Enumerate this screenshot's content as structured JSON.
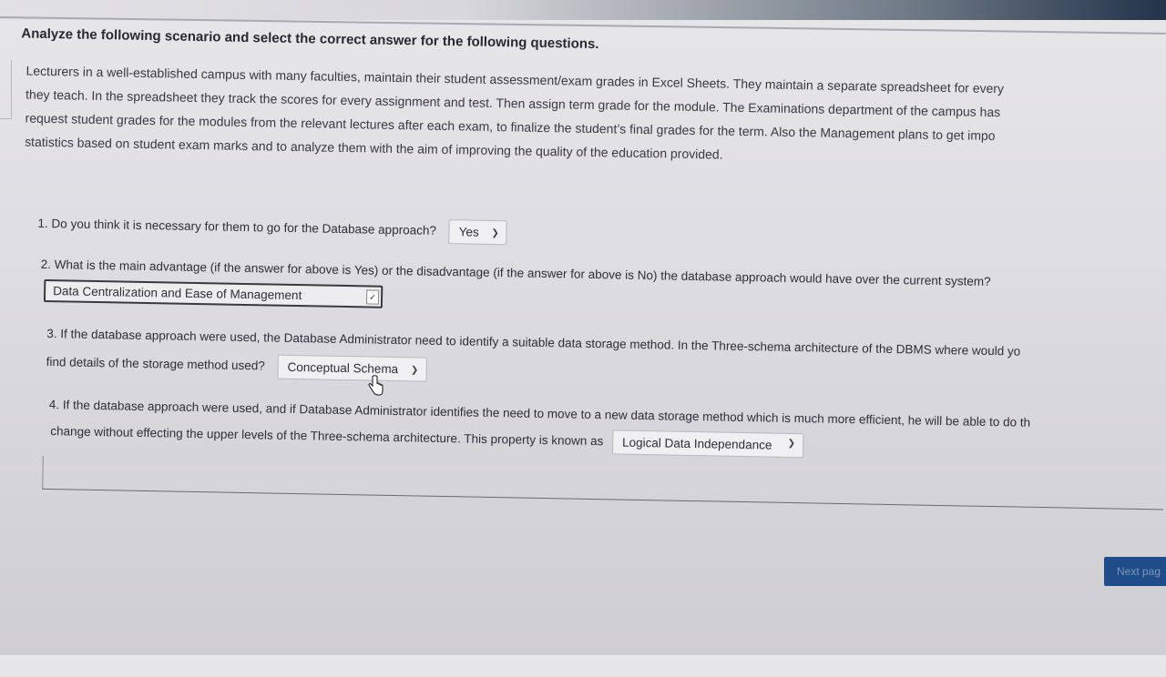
{
  "heading": "Analyze the following scenario and select the correct answer for the following questions.",
  "scenario_lines": [
    "Lecturers in a well-established campus with many faculties, maintain their student assessment/exam grades in Excel Sheets. They maintain a separate spreadsheet for every",
    "they teach. In the spreadsheet they track the scores for every assignment and test. Then assign term grade for the module. The Examinations department of the campus has",
    "request student grades for the modules from the relevant lectures after each exam, to finalize the student’s final grades for the term. Also the Management plans to get impo",
    "statistics based on student exam marks and to analyze them with the aim of improving the quality of the education provided."
  ],
  "questions": {
    "q1": {
      "text": "1. Do you think it is necessary for them to go for the Database approach?",
      "selected": "Yes"
    },
    "q2": {
      "text": "2. What is the main advantage (if the answer for above is Yes) or the disadvantage (if the answer for above is No) the database approach would have over the current system?",
      "selected": "Data Centralization and Ease of Management"
    },
    "q3": {
      "text_line1": "3. If the database approach were used, the Database Administrator need to identify a suitable data storage method. In the Three-schema architecture of the DBMS where would yo",
      "text_line2": "find details of the storage method used?",
      "selected": "Conceptual Schema"
    },
    "q4": {
      "text_line1": "4. If the database approach were used, and if Database Administrator identifies the need to move to a new data storage method which is much more efficient, he will be able to do th",
      "text_line2": "change without effecting the upper levels of the Three-schema architecture. This property is known as",
      "selected": "Logical Data Independance"
    }
  },
  "next_button": "Next pag",
  "icons": {
    "dropdown": "chevron-down-icon",
    "cursor": "hand-pointer-icon"
  }
}
